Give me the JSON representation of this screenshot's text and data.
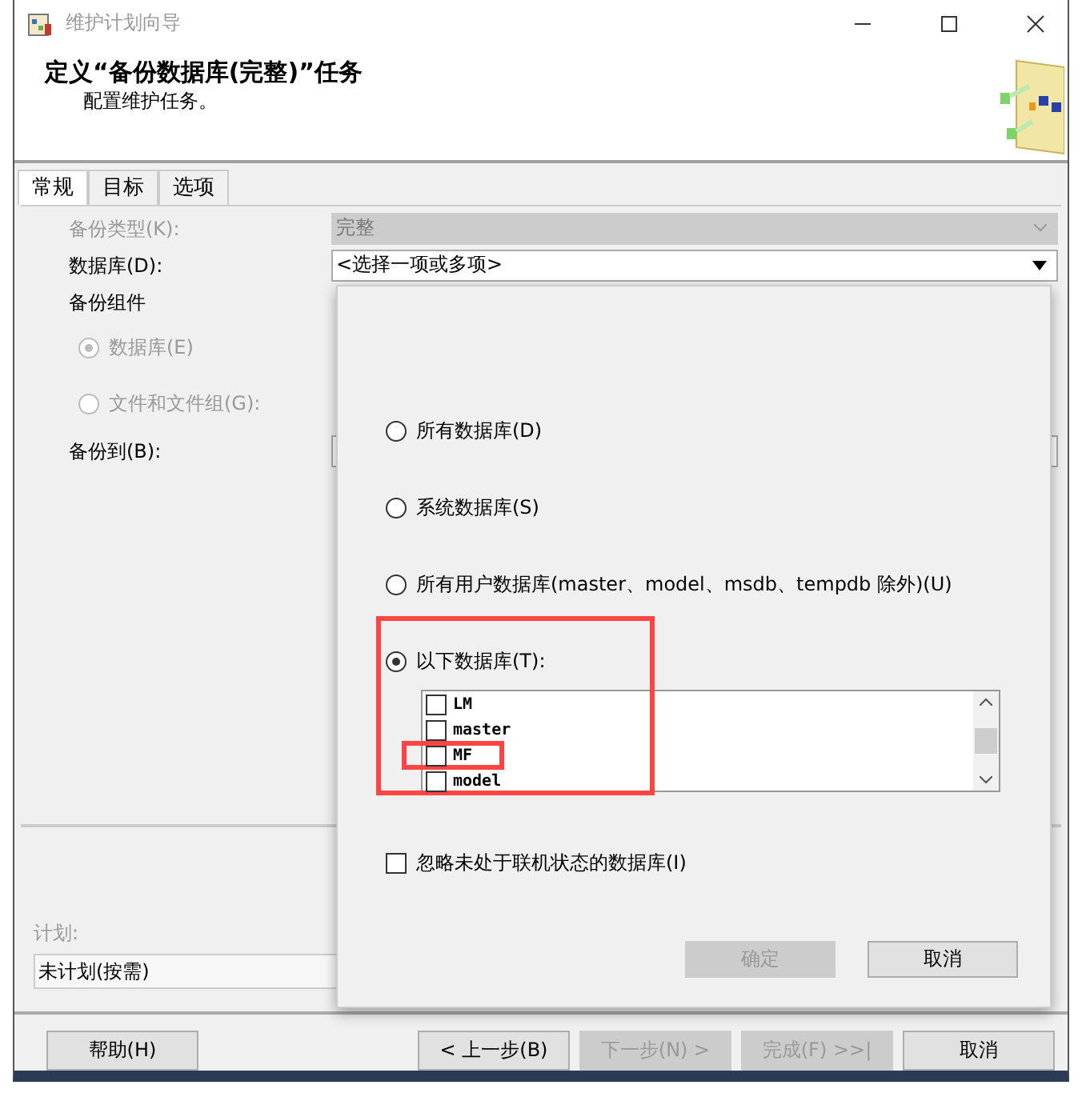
{
  "window": {
    "title": "维护计划向导"
  },
  "header": {
    "title": "定义“备份数据库(完整)”任务",
    "subtitle": "配置维护任务。"
  },
  "tabs": [
    {
      "label": "常规",
      "selected": true
    },
    {
      "label": "目标",
      "selected": false
    },
    {
      "label": "选项",
      "selected": false
    }
  ],
  "form": {
    "backup_type": {
      "label": "备份类型(K):",
      "value": "完整",
      "disabled": true
    },
    "database": {
      "label": "数据库(D):",
      "value": "<选择一项或多项>"
    },
    "backup_component": {
      "label": "备份组件"
    },
    "component_options": [
      {
        "label": "数据库(E)",
        "selected": true,
        "disabled": true
      },
      {
        "label": "文件和文件组(G):",
        "selected": false,
        "disabled": true
      }
    ],
    "backup_to": {
      "label": "备份到(B):"
    }
  },
  "schedule": {
    "label": "计划:",
    "value": "未计划(按需)"
  },
  "buttons": [
    {
      "label": "帮助(H)",
      "disabled": false
    },
    {
      "label": "< 上一步(B)",
      "disabled": false
    },
    {
      "label": "下一步(N) >",
      "disabled": true
    },
    {
      "label": "完成(F) >>|",
      "disabled": true
    },
    {
      "label": "取消",
      "disabled": false
    }
  ],
  "popup": {
    "options": [
      {
        "label": "所有数据库(D)",
        "selected": false
      },
      {
        "label": "系统数据库(S)",
        "selected": false
      },
      {
        "label": "所有用户数据库(master、model、msdb、tempdb 除外)(U)",
        "selected": false
      },
      {
        "label": "以下数据库(T):",
        "selected": true
      }
    ],
    "group_highlighted": true,
    "databases": [
      {
        "name": "LM",
        "checked": false,
        "highlighted": false
      },
      {
        "name": "master",
        "checked": false,
        "highlighted": false
      },
      {
        "name": "MF",
        "checked": false,
        "highlighted": true
      },
      {
        "name": "model",
        "checked": false,
        "highlighted": false
      }
    ],
    "ignore_offline": {
      "label": "忽略未处于联机状态的数据库(I)",
      "checked": false
    },
    "buttons": [
      {
        "label": "确定",
        "disabled": true
      },
      {
        "label": "取消",
        "disabled": false
      }
    ]
  }
}
